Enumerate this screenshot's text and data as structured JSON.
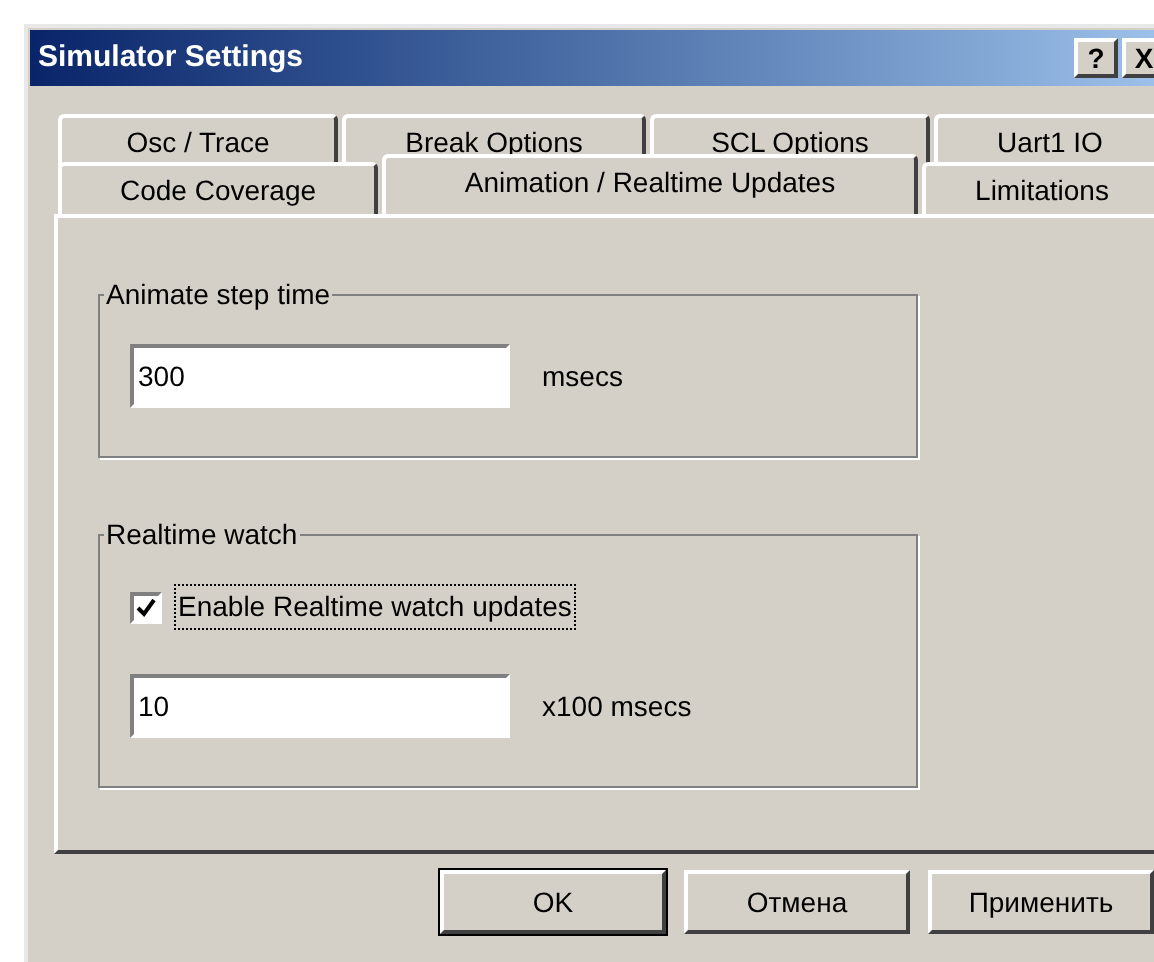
{
  "window": {
    "title": "Simulator Settings",
    "title_buttons": [
      "?",
      "X"
    ]
  },
  "tab_rows": [
    [
      {
        "label": "Osc / Trace",
        "selected": false
      },
      {
        "label": "Break Options",
        "selected": false
      },
      {
        "label": "SCL Options",
        "selected": false
      },
      {
        "label": "Uart1  IO",
        "selected": false
      }
    ],
    [
      {
        "label": "Code Coverage",
        "selected": false
      },
      {
        "label": "Animation / Realtime  Updates",
        "selected": true
      },
      {
        "label": "Limitations",
        "selected": false
      }
    ]
  ],
  "groups": [
    {
      "title": "Animate step time",
      "items": [
        {
          "kind": "field",
          "value": "300",
          "unit": "msecs"
        }
      ]
    },
    {
      "title": "Realtime watch",
      "items": [
        {
          "kind": "checkbox",
          "label": "Enable Realtime watch updates",
          "checked": true,
          "focused": true
        },
        {
          "kind": "field",
          "value": "10",
          "unit": "x100 msecs"
        }
      ]
    }
  ],
  "buttons": [
    {
      "label": "OK",
      "default": true
    },
    {
      "label": "Отмена",
      "default": false
    },
    {
      "label": "Применить",
      "default": false
    }
  ]
}
